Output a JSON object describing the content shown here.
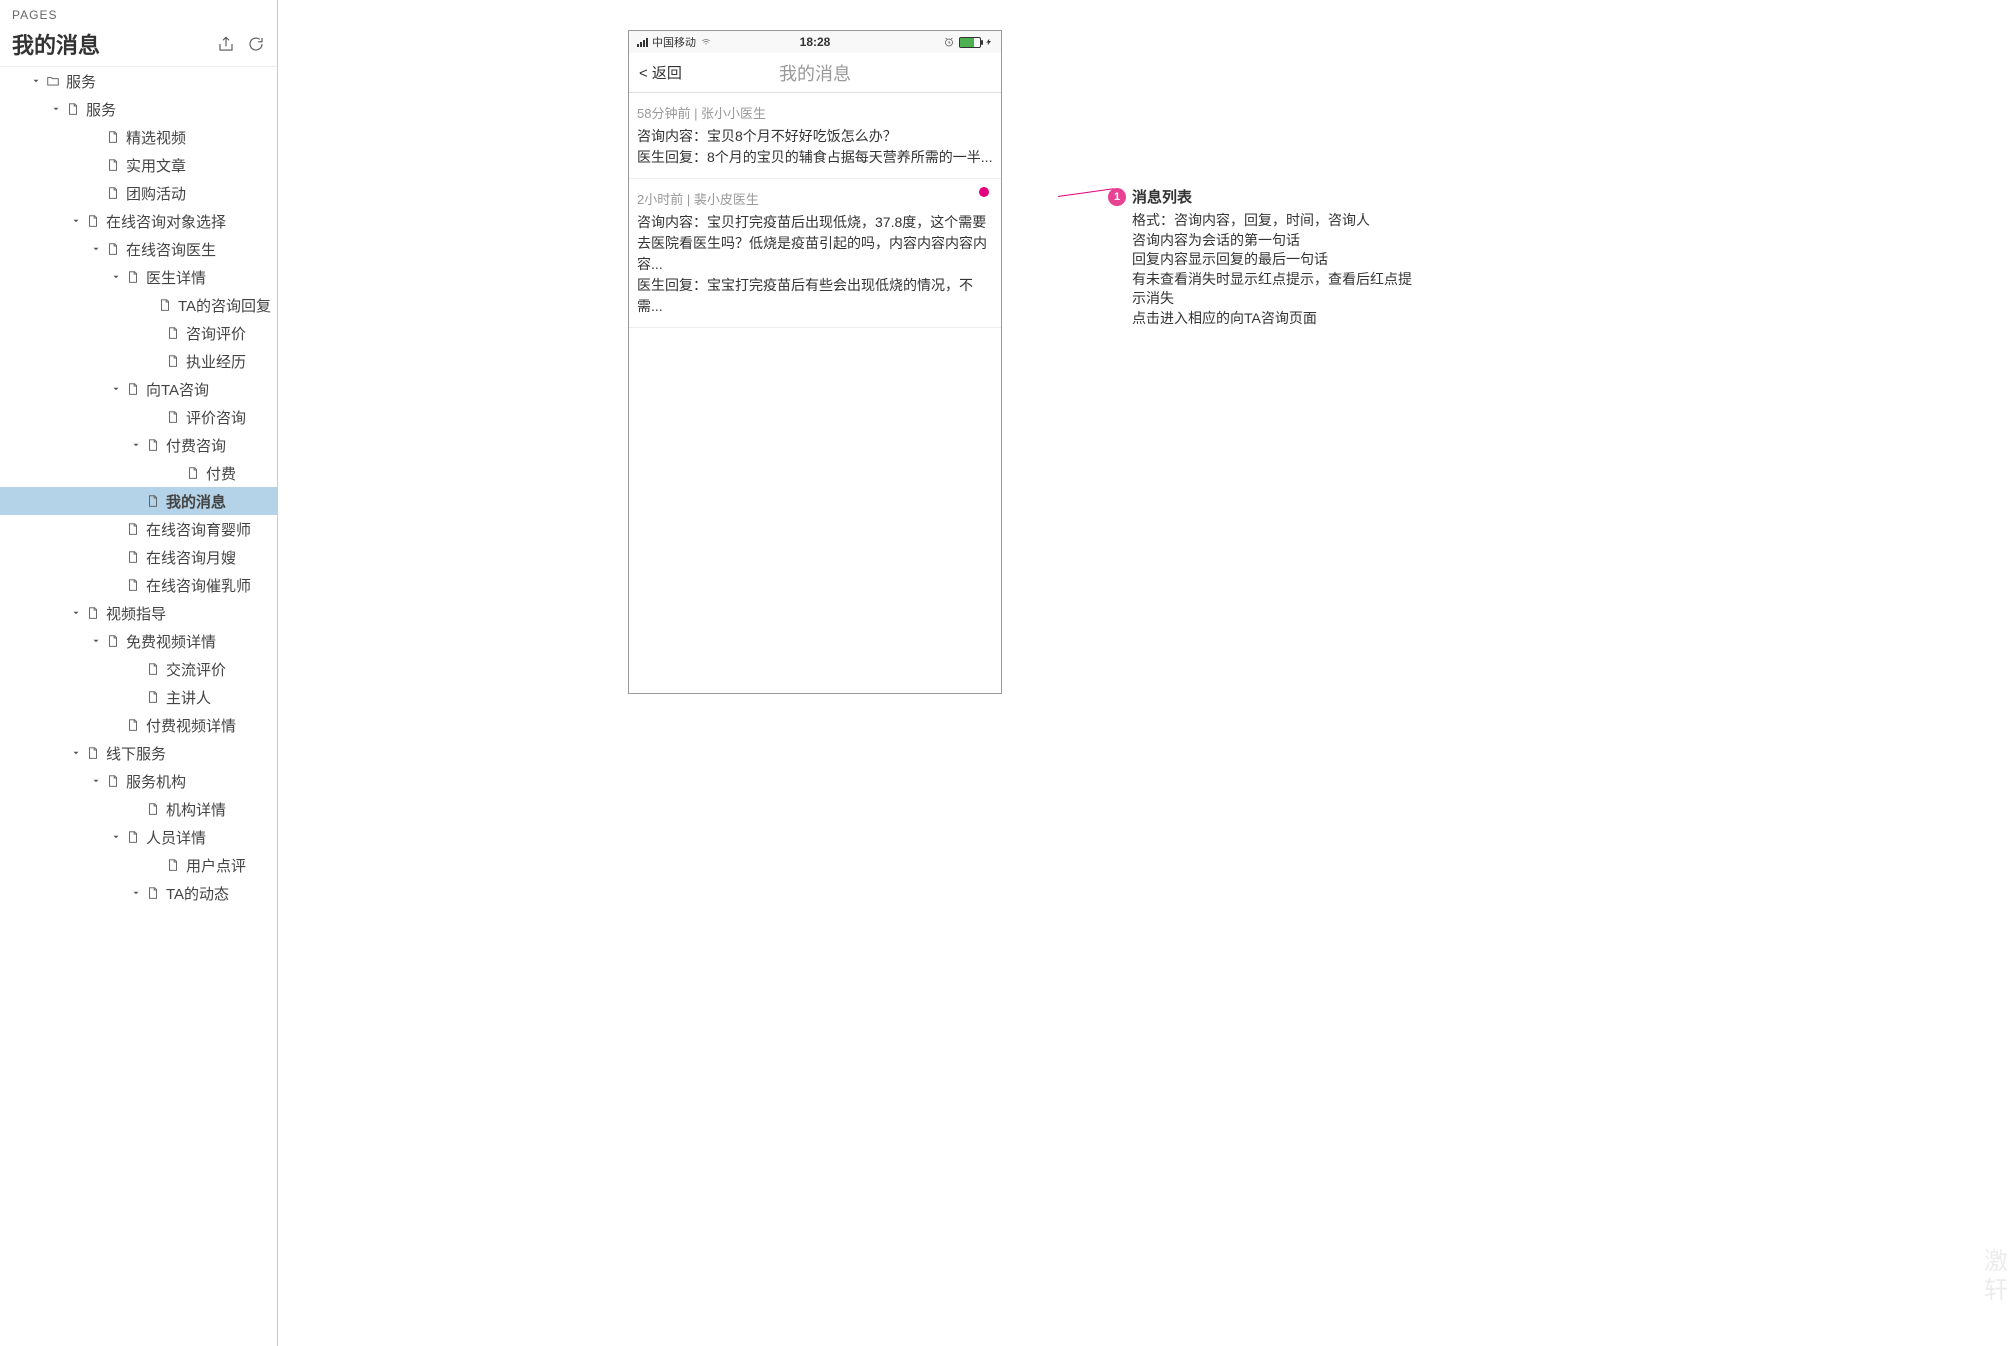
{
  "sidebar": {
    "pages_label": "PAGES",
    "title": "我的消息",
    "tree": [
      {
        "indent": 30,
        "toggle": true,
        "type": "folder",
        "label": "服务"
      },
      {
        "indent": 50,
        "toggle": true,
        "type": "page",
        "label": "服务"
      },
      {
        "indent": 90,
        "toggle": false,
        "type": "page",
        "label": "精选视频"
      },
      {
        "indent": 90,
        "toggle": false,
        "type": "page",
        "label": "实用文章"
      },
      {
        "indent": 90,
        "toggle": false,
        "type": "page",
        "label": "团购活动"
      },
      {
        "indent": 70,
        "toggle": true,
        "type": "page",
        "label": "在线咨询对象选择"
      },
      {
        "indent": 90,
        "toggle": true,
        "type": "page",
        "label": "在线咨询医生"
      },
      {
        "indent": 110,
        "toggle": true,
        "type": "page",
        "label": "医生详情"
      },
      {
        "indent": 150,
        "toggle": false,
        "type": "page",
        "label": "TA的咨询回复"
      },
      {
        "indent": 150,
        "toggle": false,
        "type": "page",
        "label": "咨询评价"
      },
      {
        "indent": 150,
        "toggle": false,
        "type": "page",
        "label": "执业经历"
      },
      {
        "indent": 110,
        "toggle": true,
        "type": "page",
        "label": "向TA咨询"
      },
      {
        "indent": 150,
        "toggle": false,
        "type": "page",
        "label": "评价咨询"
      },
      {
        "indent": 130,
        "toggle": true,
        "type": "page",
        "label": "付费咨询"
      },
      {
        "indent": 170,
        "toggle": false,
        "type": "page",
        "label": "付费"
      },
      {
        "indent": 130,
        "toggle": false,
        "type": "page",
        "label": "我的消息",
        "selected": true
      },
      {
        "indent": 110,
        "toggle": false,
        "type": "page",
        "label": "在线咨询育婴师"
      },
      {
        "indent": 110,
        "toggle": false,
        "type": "page",
        "label": "在线咨询月嫂"
      },
      {
        "indent": 110,
        "toggle": false,
        "type": "page",
        "label": "在线咨询催乳师"
      },
      {
        "indent": 70,
        "toggle": true,
        "type": "page",
        "label": "视频指导"
      },
      {
        "indent": 90,
        "toggle": true,
        "type": "page",
        "label": "免费视频详情"
      },
      {
        "indent": 130,
        "toggle": false,
        "type": "page",
        "label": "交流评价"
      },
      {
        "indent": 130,
        "toggle": false,
        "type": "page",
        "label": "主讲人"
      },
      {
        "indent": 110,
        "toggle": false,
        "type": "page",
        "label": "付费视频详情"
      },
      {
        "indent": 70,
        "toggle": true,
        "type": "page",
        "label": "线下服务"
      },
      {
        "indent": 90,
        "toggle": true,
        "type": "page",
        "label": "服务机构"
      },
      {
        "indent": 130,
        "toggle": false,
        "type": "page",
        "label": "机构详情"
      },
      {
        "indent": 110,
        "toggle": true,
        "type": "page",
        "label": "人员详情"
      },
      {
        "indent": 150,
        "toggle": false,
        "type": "page",
        "label": "用户点评"
      },
      {
        "indent": 130,
        "toggle": true,
        "type": "page",
        "label": "TA的动态"
      }
    ]
  },
  "phone": {
    "status": {
      "carrier": "中国移动",
      "time": "18:28"
    },
    "nav": {
      "back": "< 返回",
      "title": "我的消息"
    },
    "messages": [
      {
        "meta": "58分钟前 | 张小小医生",
        "consult": "咨询内容：宝贝8个月不好好吃饭怎么办？",
        "reply": "医生回复：8个月的宝贝的辅食占据每天营养所需的一半...",
        "unread": false
      },
      {
        "meta": "2小时前 | 裴小皮医生",
        "consult": "咨询内容：宝贝打完疫苗后出现低烧，37.8度，这个需要去医院看医生吗？低烧是疫苗引起的吗，内容内容内容内容...",
        "reply": "医生回复：宝宝打完疫苗后有些会出现低烧的情况，不需...",
        "unread": true
      }
    ]
  },
  "annotation": {
    "number": "1",
    "title": "消息列表",
    "lines": [
      "格式：咨询内容，回复，时间，咨询人",
      "咨询内容为会话的第一句话",
      "回复内容显示回复的最后一句话",
      "有未查看消失时显示红点提示，查看后红点提示消失",
      "点击进入相应的向TA咨询页面"
    ]
  }
}
